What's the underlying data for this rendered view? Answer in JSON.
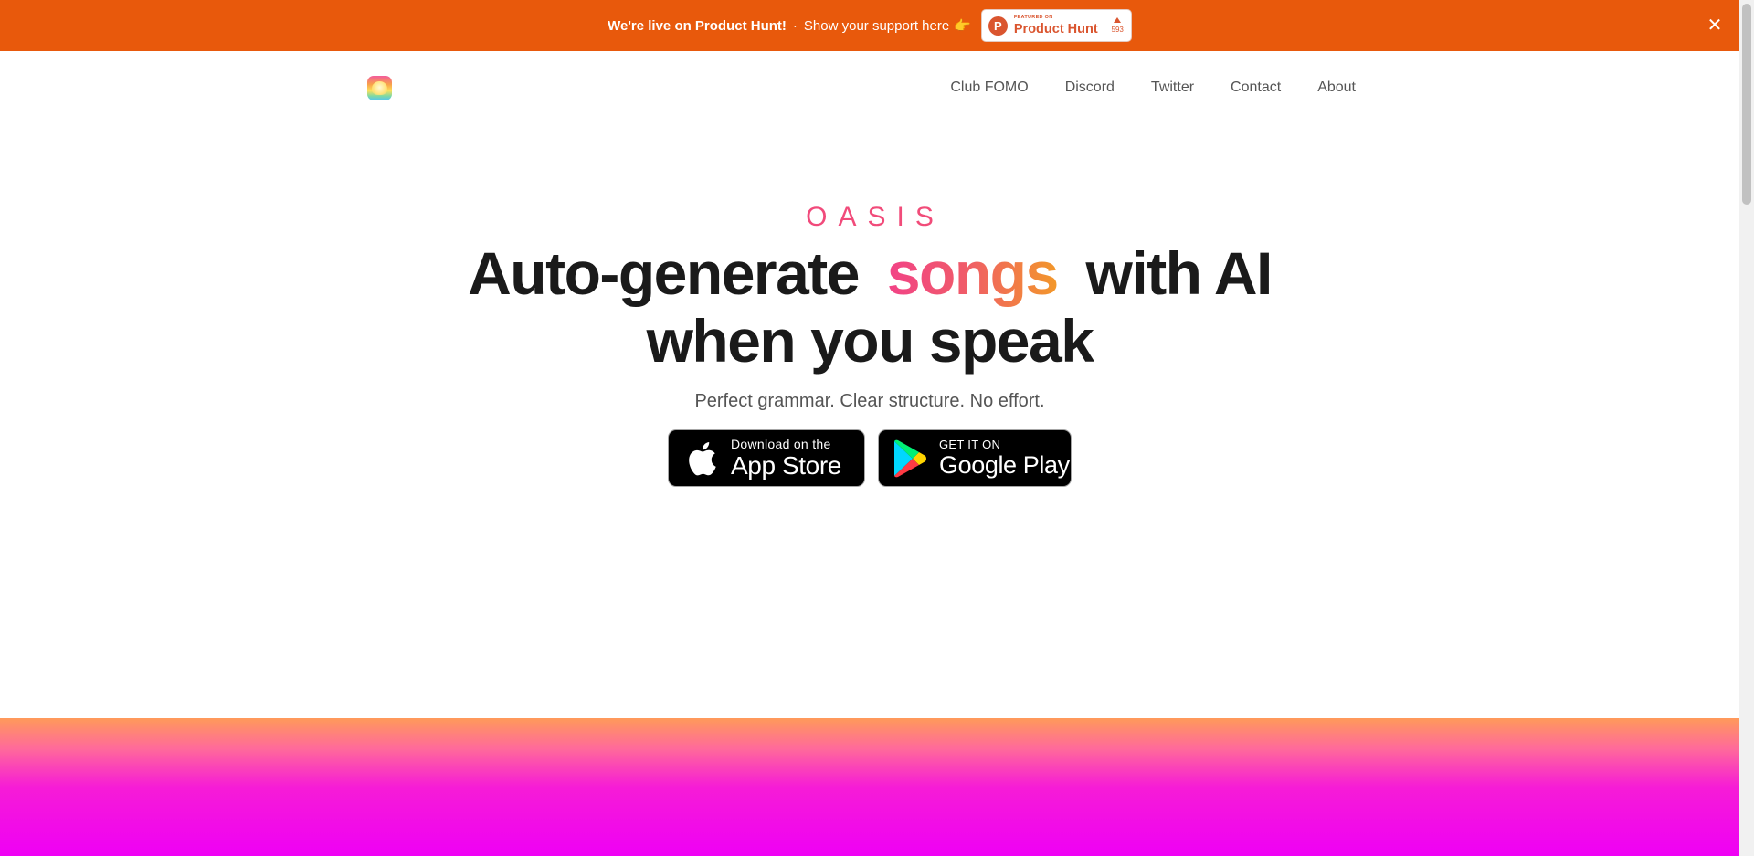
{
  "banner": {
    "live_text": "We're live on Product Hunt!",
    "separator": "·",
    "support_text": "Show your support here",
    "hand_icon": "pointing-hand-emoji",
    "badge": {
      "featured_label": "FEATURED ON",
      "name": "Product Hunt",
      "votes": "593"
    },
    "close_icon": "close-icon"
  },
  "nav": {
    "links": [
      "Club FOMO",
      "Discord",
      "Twitter",
      "Contact",
      "About"
    ]
  },
  "hero": {
    "brand": "OASIS",
    "headline_before": "Auto-generate",
    "headline_highlight": "songs",
    "headline_after": "with AI",
    "headline_line2": "when you speak",
    "subhead": "Perfect grammar. Clear structure. No effort."
  },
  "stores": {
    "apple": {
      "small": "Download on the",
      "big": "App Store"
    },
    "google": {
      "small": "GET IT ON",
      "big": "Google Play"
    }
  },
  "colors": {
    "banner": "#e8590c",
    "product_hunt": "#da552f",
    "text_dark": "#1a1a1a",
    "text_muted": "#555555"
  }
}
